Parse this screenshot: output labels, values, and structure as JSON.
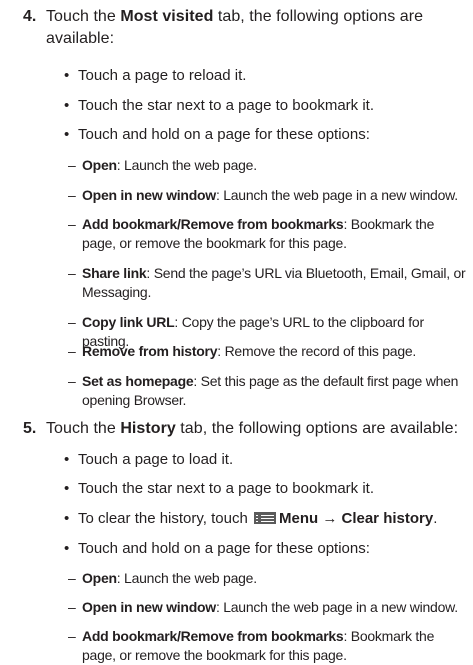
{
  "step4": {
    "number": "4.",
    "pre": "Touch the ",
    "tab": "Most visited",
    "post": " tab, the following options are",
    "line2": "available:",
    "bullets": [
      "Touch a page to reload it.",
      "Touch the star next to a page to bookmark it.",
      "Touch and hold on a page for these options:"
    ],
    "options": [
      {
        "term": "Open",
        "desc": ": Launch the web page."
      },
      {
        "term": "Open in new window",
        "desc": ": Launch the web page in a new window."
      },
      {
        "term": "Add bookmark/Remove from bookmarks",
        "desc": ": Bookmark the page, or remove the bookmark for this page."
      },
      {
        "term": "Share link",
        "desc": ": Send the page’s URL via Bluetooth, Email, Gmail, or Messaging."
      },
      {
        "term": "Copy link URL",
        "desc": ": Copy the page’s URL to the clipboard for pasting."
      },
      {
        "term": "Remove from history",
        "desc": ": Remove the record of this page."
      },
      {
        "term": "Set as homepage",
        "desc": ": Set this page as the default first page when opening Browser."
      }
    ]
  },
  "step5": {
    "number": "5.",
    "pre": "Touch the ",
    "tab": "History",
    "post": " tab, the following options are available:",
    "bullets": [
      "Touch a page to load it.",
      "Touch the star next to a page to bookmark it."
    ],
    "clear": {
      "pre": "To clear the history, touch ",
      "menu_icon": "menu-icon",
      "menu": "Menu",
      "arrow": " → ",
      "action": "Clear history",
      "post": "."
    },
    "hold": "Touch and hold on a page for these options:",
    "options": [
      {
        "term": "Open",
        "desc": ": Launch the web page."
      },
      {
        "term": "Open in new window",
        "desc": ": Launch the web page in a new window."
      },
      {
        "term": "Add bookmark/Remove from bookmarks",
        "desc": ": Bookmark the page, or remove the bookmark for this page."
      }
    ]
  },
  "markers": {
    "bullet": "•",
    "dash": "–"
  }
}
